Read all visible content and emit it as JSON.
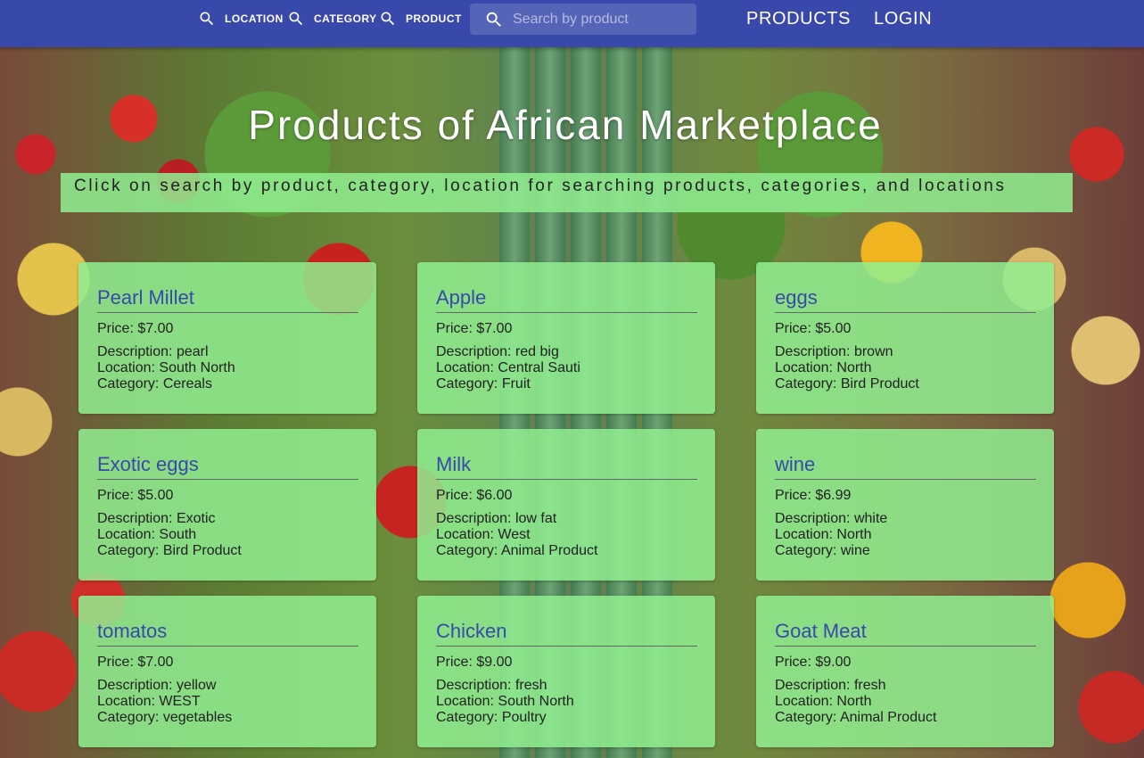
{
  "nav": {
    "location_label": "LOCATION",
    "category_label": "CATEGORY",
    "product_label": "PRODUCT",
    "search_placeholder": "Search by product",
    "products_link": "PRODUCTS",
    "login_link": "LOGIN",
    "icon": "search-icon"
  },
  "colors": {
    "appbar": "#3949ab",
    "card_bg": "#90ee90",
    "card_title": "#3949ab"
  },
  "hero": {
    "title": "Products of African Marketplace",
    "subtitle": "Click on search by product, category, location for searching products, categories, and locations"
  },
  "labels": {
    "price": "Price:",
    "description": "Description:",
    "location": "Location:",
    "category": "Category:"
  },
  "products": [
    {
      "name": "Pearl Millet",
      "price": "$7.00",
      "description": "pearl",
      "location": "South North",
      "category": "Cereals"
    },
    {
      "name": "Apple",
      "price": "$7.00",
      "description": "red big",
      "location": "Central Sauti",
      "category": "Fruit"
    },
    {
      "name": "eggs",
      "price": "$5.00",
      "description": "brown",
      "location": "North",
      "category": "Bird Product"
    },
    {
      "name": "Exotic eggs",
      "price": "$5.00",
      "description": "Exotic",
      "location": "South",
      "category": "Bird Product"
    },
    {
      "name": "Milk",
      "price": "$6.00",
      "description": "low fat",
      "location": "West",
      "category": "Animal Product"
    },
    {
      "name": "wine",
      "price": "$6.99",
      "description": "white",
      "location": "North",
      "category": "wine"
    },
    {
      "name": "tomatos",
      "price": "$7.00",
      "description": "yellow",
      "location": "WEST",
      "category": "vegetables"
    },
    {
      "name": "Chicken",
      "price": "$9.00",
      "description": "fresh",
      "location": "South North",
      "category": "Poultry"
    },
    {
      "name": "Goat Meat",
      "price": "$9.00",
      "description": "fresh",
      "location": "North",
      "category": "Animal Product"
    }
  ]
}
